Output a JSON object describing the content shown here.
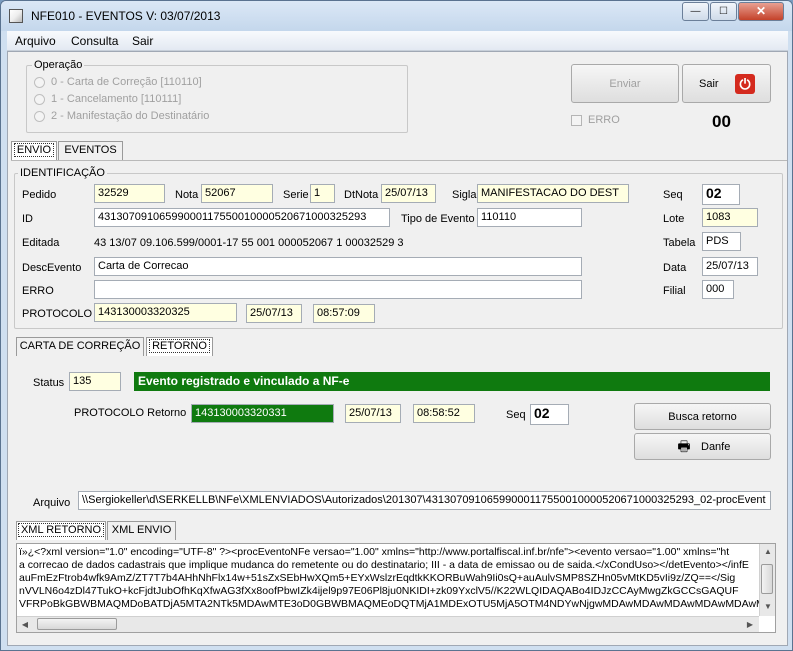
{
  "window": {
    "title": "NFE010 - EVENTOS   V: 03/07/2013",
    "minimize": "—",
    "maximize": "☐",
    "close": "✕"
  },
  "menu": [
    "Arquivo",
    "Consulta",
    "Sair"
  ],
  "operacao": {
    "title": "Operação",
    "options": [
      "0 - Carta de Correção  [110110]",
      "1 - Cancelamento [110111]",
      "2 - Manifestação do Destinatário"
    ]
  },
  "buttons": {
    "enviar": "Enviar",
    "sair": "Sair",
    "busca_retorno": "Busca retorno",
    "danfe": "Danfe"
  },
  "erro_check": "ERRO",
  "counter": "00",
  "top_tabs": [
    "ENVIO",
    "EVENTOS"
  ],
  "identificacao": {
    "title": "IDENTIFICAÇÃO",
    "pedido_label": "Pedido",
    "pedido": "32529",
    "nota_label": "Nota",
    "nota": "52067",
    "serie_label": "Serie",
    "serie": "1",
    "dtnota_label": "DtNota",
    "dtnota": "25/07/13",
    "sigla_label": "Sigla",
    "sigla": "MANIFESTACAO DO DEST",
    "seq_label": "Seq",
    "seq": "02",
    "id_label": "ID",
    "id": "43130709106599000117550010000520671000325293",
    "tipo_evento_label": "Tipo de Evento",
    "tipo_evento": "110110",
    "lote_label": "Lote",
    "lote": "1083",
    "editada_label": "Editada",
    "editada": "43  13/07  09.106.599/0001-17  55  001  000052067  1  00032529  3",
    "tabela_label": "Tabela",
    "tabela": "PDS",
    "descevento_label": "DescEvento",
    "descevento": "Carta de Correcao",
    "data_label": "Data",
    "data": "25/07/13",
    "erro_label": "ERRO",
    "erro": "",
    "filial_label": "Filial",
    "filial": "000",
    "protocolo_label": "PROTOCOLO",
    "protocolo": "143130003320325",
    "protocolo_data": "25/07/13",
    "protocolo_hora": "08:57:09"
  },
  "sub_tabs": [
    "CARTA DE CORREÇÃO",
    "RETORNO"
  ],
  "retorno": {
    "status_label": "Status",
    "status": "135",
    "status_msg": "Evento registrado e vinculado a NF-e",
    "protocolo_label": "PROTOCOLO Retorno",
    "protocolo": "143130003320331",
    "data": "25/07/13",
    "hora": "08:58:52",
    "seq_label": "Seq",
    "seq": "02"
  },
  "arquivo": {
    "label": "Arquivo",
    "path": "\\\\Sergiokeller\\d\\SERKELLB\\NFe\\XMLENVIADOS\\Autorizados\\201307\\43130709106599000117550010000520671000325293_02-procEvent"
  },
  "xml_tabs": [
    "XML RETORNO",
    "XML ENVIO"
  ],
  "xml_lines": [
    "ï»¿<?xml version=\"1.0\" encoding=\"UTF-8\" ?><procEventoNFe versao=\"1.00\" xmlns=\"http://www.portalfiscal.inf.br/nfe\"><evento versao=\"1.00\" xmlns=\"ht",
    "a correcao de dados cadastrais que implique mudanca do remetente ou do destinatario; III - a data de emissao ou de saida.</xCondUso></detEvento></infE",
    "auFmEzFtrob4wfk9AmZ/ZT7T7b4AHhNhFlx14w+51sZxSEbHwXQm5+EYxWslzrEqdtkKKORBuWah9Ii0sQ+auAulvSMP8SZHn05vMtKD5vIi9z/ZQ==</Sig",
    "nVVLN6o4zDl47TukO+kcFjdtJubOfhKqXfwAG3fXx8oofPbwIZk4ijel9p97E06Pl8ju0NKIDI+zk09YxclV5//K22WLQIDAQABo4IDJzCCAyMwgZkGCCsGAQUF",
    "VFRPoBkGBWBMAQMDoBATDjA5MTA2NTk5MDAwMTE3oD0GBWBMAQMEoDQTMjA1MDExOTU5MjA5OTM4NDYwNjgwMDAwMDAwMDAwMDAwMDAwMDAwM"
  ]
}
